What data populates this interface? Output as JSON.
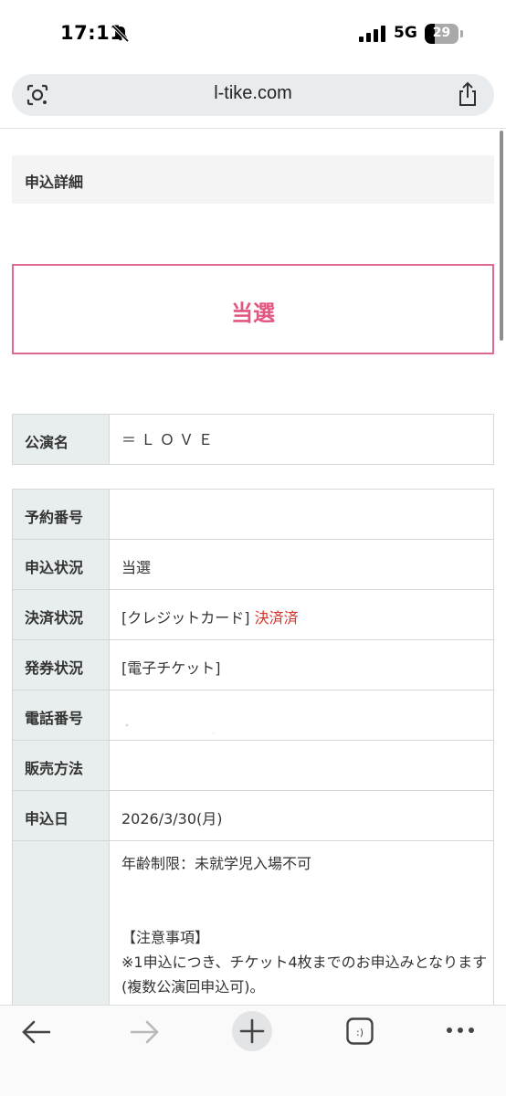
{
  "status_bar": {
    "time": "17:11",
    "network": "5G",
    "battery_level": "29",
    "battery_fraction": 0.29,
    "icons": [
      "bell-slash-icon",
      "signal-bars-icon",
      "battery-icon"
    ]
  },
  "browser": {
    "url": "l-tike.com",
    "icons": [
      "lens-icon",
      "share-icon"
    ]
  },
  "page": {
    "section_title": "申込詳細",
    "result": "当選",
    "performance": {
      "label": "公演名",
      "value": "＝ＬＯＶＥ"
    },
    "details": [
      {
        "label": "予約番号",
        "value": ""
      },
      {
        "label": "申込状況",
        "value": "当選"
      },
      {
        "label": "決済状況",
        "value": "[クレジットカード]",
        "badge": "決済済"
      },
      {
        "label": "発券状況",
        "value": "[電子チケット]"
      },
      {
        "label": "電話番号",
        "value": ""
      },
      {
        "label": "販売方法",
        "value": ""
      },
      {
        "label": "申込日",
        "value": "2026/3/30(月)"
      }
    ],
    "notes": {
      "age_limit": "年齢制限：未就学児入場不可",
      "heading": "【注意事項】",
      "line1": "※1申込につき、チケット4枚までのお申込みとなります(複数公演回申込可)。"
    }
  },
  "toolbar": {
    "icons": [
      "back-arrow-icon",
      "forward-arrow-icon",
      "plus-icon",
      "tab-switcher-icon",
      "more-icon"
    ],
    "tab_switcher_label": ":)"
  },
  "colors": {
    "accent_pink": "#e2577f",
    "teal": "#4fbfbf",
    "paid_red": "#d93025",
    "label_bg": "#e8edee"
  }
}
